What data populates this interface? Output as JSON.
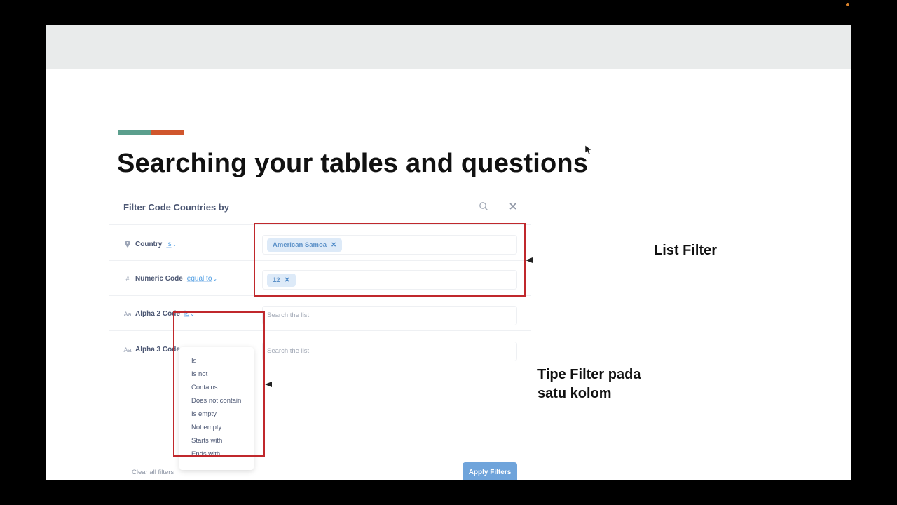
{
  "slide": {
    "title": "Searching your tables and questions",
    "accent_colors": [
      "#5b9f8d",
      "#d0562d"
    ]
  },
  "filter_panel": {
    "title": "Filter Code Countries by",
    "rows": [
      {
        "icon": "pin-icon",
        "glyph": "●",
        "name": "Country",
        "operator": "is",
        "chip": "American Samoa"
      },
      {
        "icon": "hash-icon",
        "glyph": "#",
        "name": "Numeric Code",
        "operator": "equal to",
        "chip": "12"
      },
      {
        "icon": "text-icon",
        "glyph": "Aa",
        "name": "Alpha 2 Code",
        "operator": "is",
        "placeholder": "Search the list"
      },
      {
        "icon": "text-icon",
        "glyph": "Aa",
        "name": "Alpha 3 Code",
        "placeholder": "Search the list"
      }
    ],
    "operator_options": [
      "Is",
      "Is not",
      "Contains",
      "Does not contain",
      "Is empty",
      "Not empty",
      "Starts with",
      "Ends with"
    ],
    "clear_label": "Clear all filters",
    "apply_label": "Apply Filters",
    "apply_color": "#6fa4db"
  },
  "annotations": {
    "list_filter": "List Filter",
    "filter_type_line1": "Tipe Filter pada",
    "filter_type_line2": "satu kolom",
    "box_color": "#c0282c"
  }
}
